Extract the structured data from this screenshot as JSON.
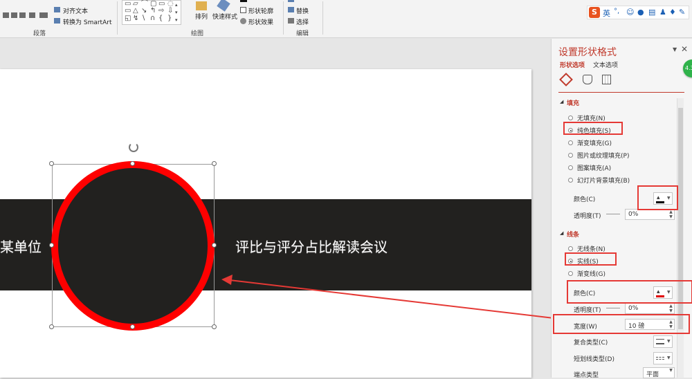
{
  "ribbon": {
    "paragraph": {
      "align_text": "对齐文本",
      "convert_smartart": "转换为 SmartArt",
      "label": "段落"
    },
    "drawing": {
      "arrange": "排列",
      "quick_styles": "快速样式",
      "shape_outline": "形状轮廓",
      "shape_effects": "形状效果",
      "label": "绘图"
    },
    "editing": {
      "replace": "替换",
      "select": "选择",
      "label": "编辑"
    }
  },
  "ime": {
    "mode": "英",
    "punct": "°,"
  },
  "slide": {
    "left_text": "某单位",
    "right_text": "评比与评分占比解读会议"
  },
  "pane": {
    "title": "设置形状格式",
    "tab_shape": "形状选项",
    "tab_text": "文本选项",
    "fill": {
      "heading": "填充",
      "options": [
        "无填充(N)",
        "纯色填充(S)",
        "渐变填充(G)",
        "图片或纹理填充(P)",
        "图案填充(A)",
        "幻灯片背景填充(B)"
      ],
      "selected_index": 1,
      "color_label": "颜色(C)",
      "transparency_label": "透明度(T)",
      "transparency_value": "0%"
    },
    "line": {
      "heading": "线条",
      "options": [
        "无线条(N)",
        "实线(S)",
        "渐变线(G)"
      ],
      "selected_index": 1,
      "color_label": "颜色(C)",
      "transparency_label": "透明度(T)",
      "transparency_value": "0%",
      "width_label": "宽度(W)",
      "width_value": "10 磅",
      "compound_label": "复合类型(C)",
      "dash_label": "短划线类型(D)",
      "cap_label": "端点类型",
      "cap_value": "平面"
    }
  },
  "badge": "4.3",
  "colors": {
    "accent": "#c0392b",
    "highlight": "#e53935",
    "band": "#22211f",
    "circle_fill": "#22211f",
    "circle_outline": "#ff0000"
  }
}
